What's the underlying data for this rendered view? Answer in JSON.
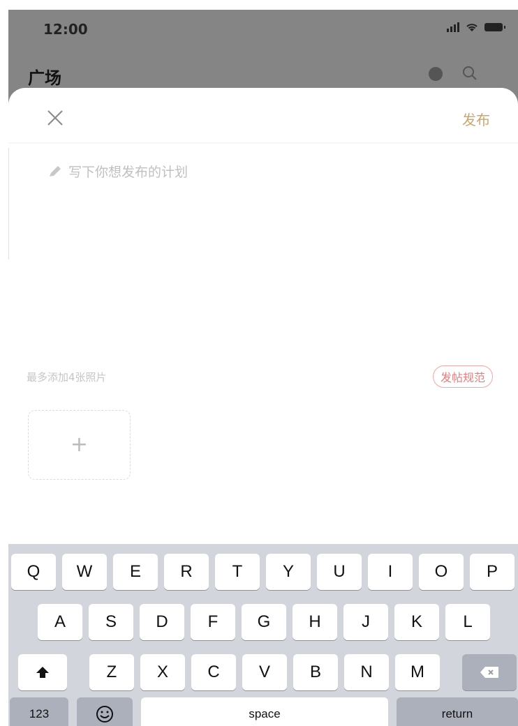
{
  "status_bar": {
    "time": "12:00"
  },
  "background": {
    "title": "广场"
  },
  "compose": {
    "publish_label": "发布",
    "placeholder": "写下你想发布的计划",
    "photo_limit_text": "最多添加4张照片",
    "guidelines_label": "发帖规范",
    "add_photo_symbol": "+"
  },
  "keyboard": {
    "row1": [
      "Q",
      "W",
      "E",
      "R",
      "T",
      "Y",
      "U",
      "I",
      "O",
      "P"
    ],
    "row2": [
      "A",
      "S",
      "D",
      "F",
      "G",
      "H",
      "J",
      "K",
      "L"
    ],
    "row3": [
      "Z",
      "X",
      "C",
      "V",
      "B",
      "N",
      "M"
    ],
    "numbers_label": "123",
    "space_label": "space",
    "return_label": "return"
  },
  "colors": {
    "accent": "#c9a66b",
    "guidelines": "#e77e7e",
    "dim": "#858585"
  }
}
